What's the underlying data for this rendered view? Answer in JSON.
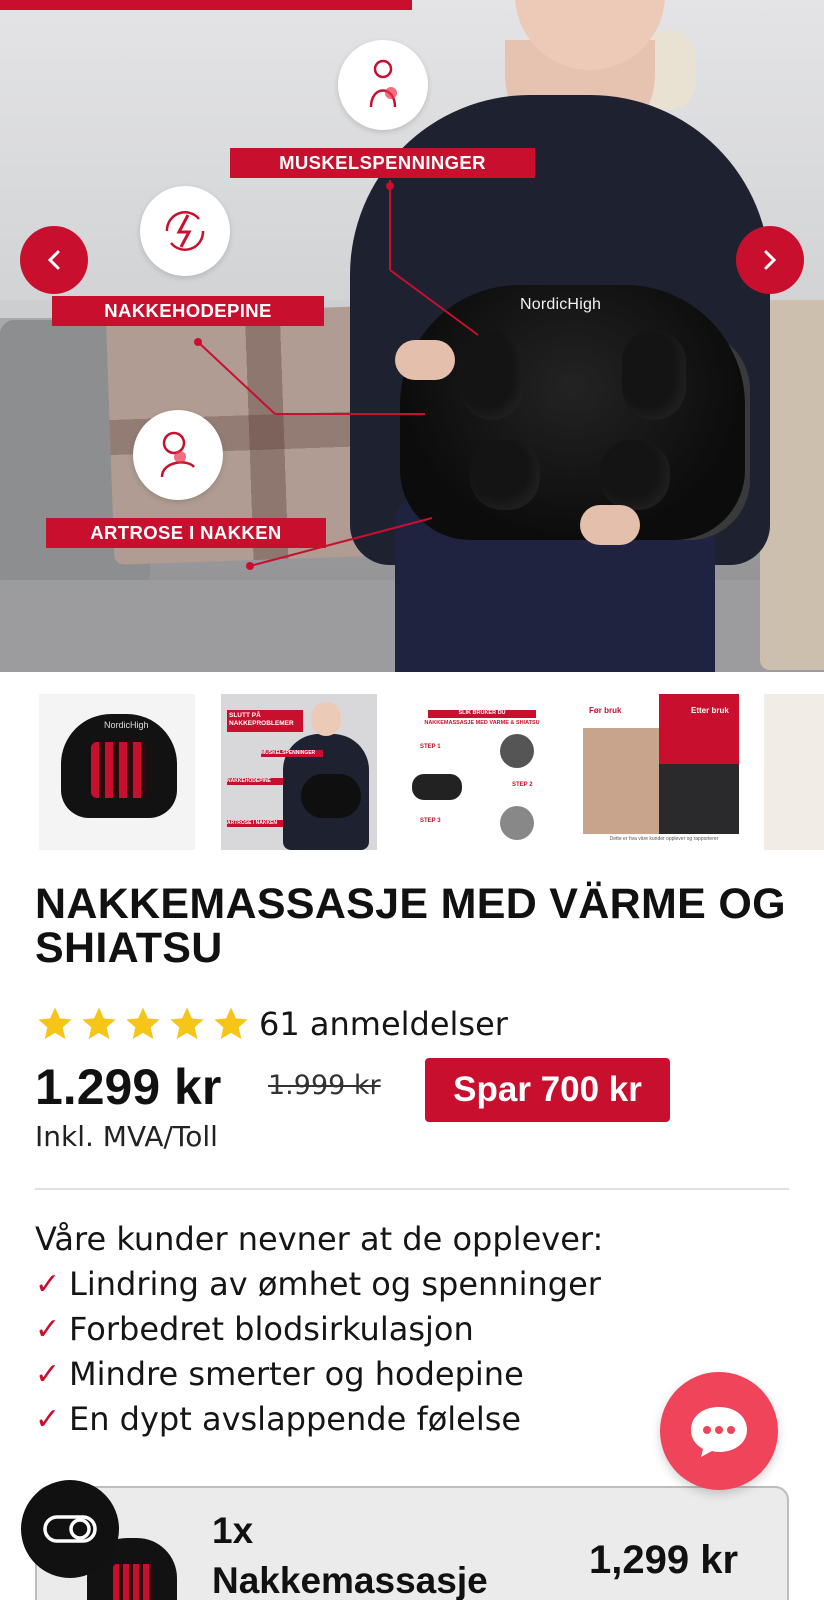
{
  "hero": {
    "brand_text": "NordicHigh",
    "labels": {
      "muscle": "MUSKELSPENNINGER",
      "headache": "NAKKEHODEPINE",
      "arthrosis": "ARTROSE I NAKKEN"
    },
    "prev_icon": "chevron-left-icon",
    "next_icon": "chevron-right-icon"
  },
  "thumbnails": {
    "t1_brand": "NordicHigh",
    "t2_title": "SLUTT PÅ NAKKEPROBLEMER",
    "t2_label1": "MUSKELSPENNINGER",
    "t2_label2": "NAKKEHODEPINE",
    "t2_label3": "ARTROSE I NAKKEN",
    "t3_title": "SLIK BRUKER DU NAKKEMASSASJE MED VARME & SHIATSU",
    "t3_step1": "STEP 1",
    "t3_step2": "STEP 2",
    "t3_step3": "STEP 3",
    "t4_before": "Før bruk",
    "t4_after": "Etter bruk",
    "t4_caption": "Dette er hva våre kunder opplever og rapporterer"
  },
  "product": {
    "title": "NAKKEMASSASJE MED VÄRME OG SHIATSU",
    "rating": 5,
    "review_count": "61 anmeldelser",
    "price": "1.299 kr",
    "old_price": "1.999 kr",
    "save_badge": "Spar 700 kr",
    "tax_note": "Inkl. MVA/Toll"
  },
  "benefits": {
    "intro": "Våre kunder nevner at de opplever:",
    "items": [
      "Lindring av ømhet og spenninger",
      "Forbedret blodsirkulasjon",
      "Mindre smerter og hodepine",
      "En dypt avslappende følelse"
    ]
  },
  "bundle": {
    "qty": "1x",
    "name": "Nakkemassasje",
    "price": "1,299 kr"
  },
  "colors": {
    "accent": "#c8102e",
    "star": "#f5c518",
    "chat": "#ef4459"
  }
}
